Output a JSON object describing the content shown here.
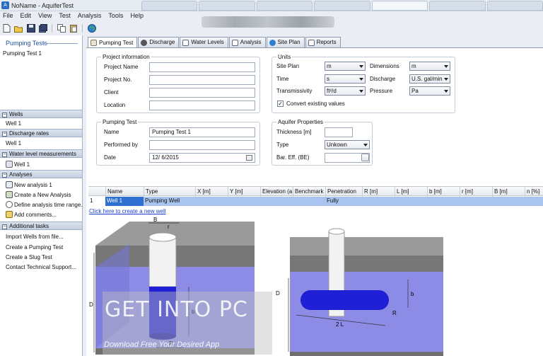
{
  "window": {
    "title": "NoName - AquiferTest"
  },
  "menu": [
    "File",
    "Edit",
    "View",
    "Test",
    "Analysis",
    "Tools",
    "Help"
  ],
  "toolbar": {
    "icons": [
      "new-file-icon",
      "open-folder-icon",
      "save-icon",
      "save-all-icon",
      "copy-icon",
      "paste-icon",
      "globe-icon"
    ]
  },
  "sidebar": {
    "title": "Pumping Tests",
    "test_item": "Pumping Test 1",
    "sections": {
      "wells": {
        "label": "Wells",
        "items": [
          "Well 1"
        ]
      },
      "discharge": {
        "label": "Discharge rates",
        "items": [
          "Well 1"
        ]
      },
      "water_level": {
        "label": "Water level measurements",
        "items": [
          "Well 1"
        ]
      },
      "analyses": {
        "label": "Analyses",
        "items": [
          "New analysis 1",
          "Create a New Analysis",
          "Define analysis time range...",
          "Add comments..."
        ]
      },
      "additional": {
        "label": "Additional tasks",
        "items": [
          "Import Wells from file...",
          "Create a Pumping Test",
          "Create a Slug Test",
          "Contact Technical Support..."
        ]
      }
    }
  },
  "tabs": [
    "Pumping Test",
    "Discharge",
    "Water Levels",
    "Analysis",
    "Site Plan",
    "Reports"
  ],
  "project": {
    "group_title": "Project information",
    "labels": {
      "name": "Project Name",
      "no": "Project No.",
      "client": "Client",
      "location": "Location"
    },
    "values": {
      "name": "",
      "no": "",
      "client": "",
      "location": ""
    }
  },
  "units": {
    "group_title": "Units",
    "site_plan": {
      "label": "Site Plan",
      "value": "m"
    },
    "time": {
      "label": "Time",
      "value": "s"
    },
    "transmissivity": {
      "label": "Transmissivity",
      "value": "ft²/d"
    },
    "dimensions": {
      "label": "Dimensions",
      "value": "m"
    },
    "discharge": {
      "label": "Discharge",
      "value": "U.S. gal/min"
    },
    "pressure": {
      "label": "Pressure",
      "value": "Pa"
    },
    "convert": {
      "label": "Convert existing values",
      "checked": true
    }
  },
  "pumping_test": {
    "group_title": "Pumping Test",
    "labels": {
      "name": "Name",
      "performed_by": "Performed by",
      "date": "Date"
    },
    "values": {
      "name": "Pumping Test 1",
      "performed_by": "",
      "date": "12/ 6/2015"
    }
  },
  "aquifer": {
    "group_title": "Aquifer Properties",
    "labels": {
      "thickness": "Thickness [m]",
      "type": "Type",
      "bar_eff": "Bar. Eff. (BE)"
    },
    "values": {
      "thickness": "",
      "type": "Unkown",
      "bar_eff": ""
    }
  },
  "wells_table": {
    "columns": [
      "Name",
      "Type",
      "X [m]",
      "Y [m]",
      "Elevation (a",
      "Benchmark [",
      "Penetration",
      "R [m]",
      "L [m]",
      "b [m]",
      "r [m]",
      "B [m]",
      "n [%]"
    ],
    "rows": [
      {
        "num": "1",
        "name": "Well 1",
        "type": "Pumping Well",
        "penetration": "Fully"
      }
    ],
    "new_link": "Click here to create a new well"
  },
  "diagram_labels": {
    "B": "B",
    "r": "r",
    "D_left": "D",
    "b_left": "b",
    "R_left": "R",
    "D_right": "D",
    "b_right": "b",
    "R_right": "R",
    "L": "2 L"
  },
  "watermark": {
    "title": "GET INTO PC",
    "subtitle": "Download Free Your Desired App"
  },
  "colors": {
    "accent": "#2f6fcf",
    "water": "#8f8fe6",
    "well_blue": "#1f1fd6"
  }
}
